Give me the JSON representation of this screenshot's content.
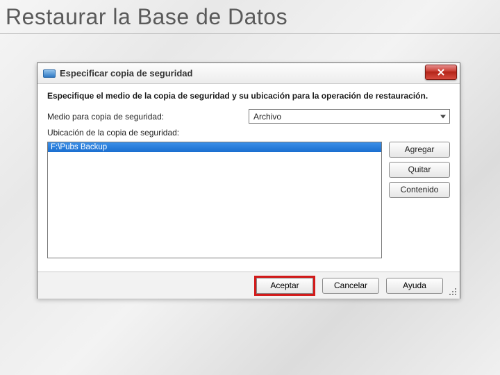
{
  "slide": {
    "title": "Restaurar la Base de Datos"
  },
  "dialog": {
    "title": "Especificar copia de seguridad",
    "instruction": "Especifique el medio de la copia de seguridad y su ubicación para la operación de restauración.",
    "media_label": "Medio para copia de seguridad:",
    "media_value": "Archivo",
    "location_label": "Ubicación de la copia de seguridad:",
    "location_items": [
      "F:\\Pubs Backup"
    ],
    "buttons": {
      "add": "Agregar",
      "remove": "Quitar",
      "contents": "Contenido",
      "ok": "Aceptar",
      "cancel": "Cancelar",
      "help": "Ayuda"
    }
  }
}
